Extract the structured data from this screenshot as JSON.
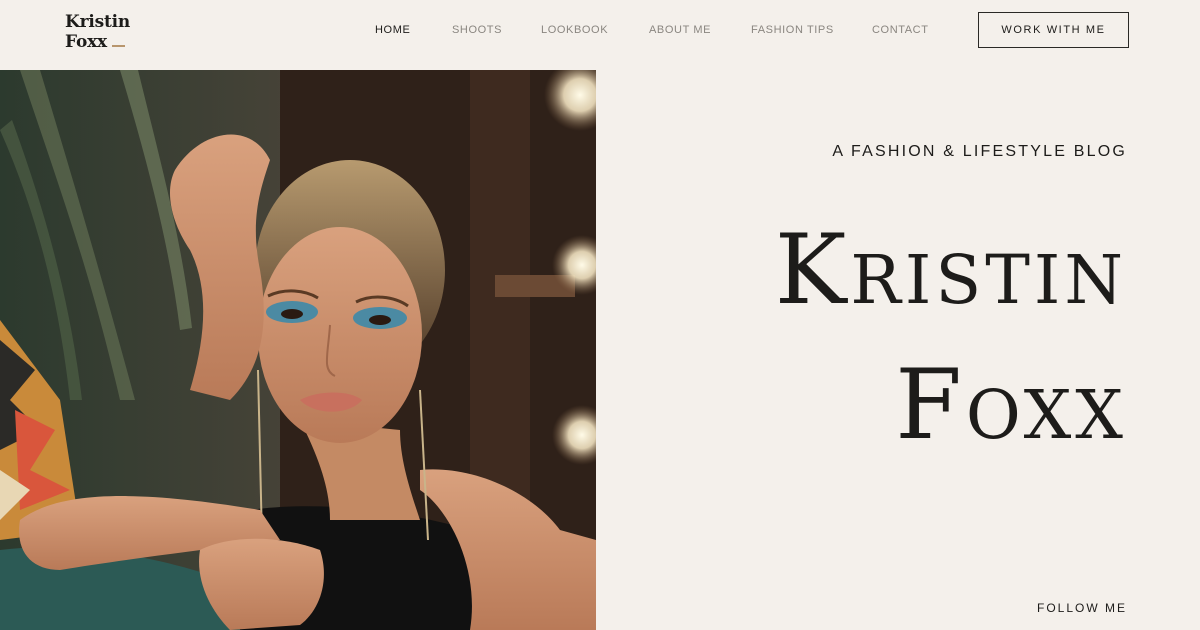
{
  "brand": {
    "line1": "Kristin",
    "line2": "Foxx",
    "accent": "#b8966d"
  },
  "nav": {
    "items": [
      {
        "label": "HOME",
        "active": true
      },
      {
        "label": "SHOOTS",
        "active": false
      },
      {
        "label": "LOOKBOOK",
        "active": false
      },
      {
        "label": "ABOUT ME",
        "active": false
      },
      {
        "label": "FASHION TIPS",
        "active": false
      },
      {
        "label": "CONTACT",
        "active": false
      }
    ],
    "cta_label": "WORK WITH ME"
  },
  "hero": {
    "tagline": "A FASHION & LIFESTYLE BLOG",
    "name_line1": "Kristin",
    "name_line2": "Foxx",
    "follow_label": "FOLLOW ME",
    "photo_icon": "portrait-photo"
  },
  "colors": {
    "background": "#f4f0eb",
    "text": "#1d1c1a",
    "muted_nav": "#8a8680"
  }
}
